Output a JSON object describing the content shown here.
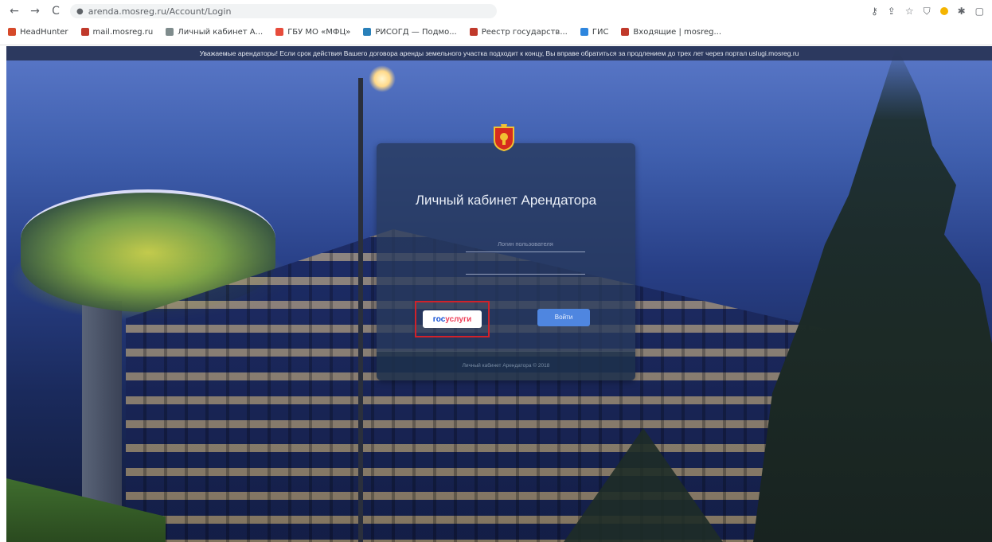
{
  "browser": {
    "url": "arenda.mosreg.ru/Account/Login",
    "nav_back": "←",
    "nav_forward": "→",
    "nav_reload": "C",
    "bookmarks": [
      {
        "label": "HeadHunter",
        "color": "#d64a2a"
      },
      {
        "label": "mail.mosreg.ru",
        "color": "#c0392b"
      },
      {
        "label": "Личный кабинет А...",
        "color": "#7f8c8d"
      },
      {
        "label": "ГБУ МО «МФЦ»",
        "color": "#e74c3c"
      },
      {
        "label": "РИСОГД — Подмо...",
        "color": "#2980b9"
      },
      {
        "label": "Реестр государств...",
        "color": "#c0392b"
      },
      {
        "label": "ГИС",
        "color": "#2e86de"
      },
      {
        "label": "Входящие | mosreg...",
        "color": "#c0392b"
      }
    ]
  },
  "notice": "Уважаемые арендаторы! Если срок действия Вашего договора аренды земельного участка подходит к концу, Вы вправе обратиться за продлением до трех лет через портал uslugi.mosreg.ru",
  "card": {
    "title": "Личный кабинет Арендатора",
    "login_placeholder": "Логин пользователя",
    "password_placeholder": "",
    "gosuslugi_part1": "гос",
    "gosuslugi_part2": "услуги",
    "login_button": "Войти",
    "footer": "Личный кабинет Арендатора © 2018"
  }
}
